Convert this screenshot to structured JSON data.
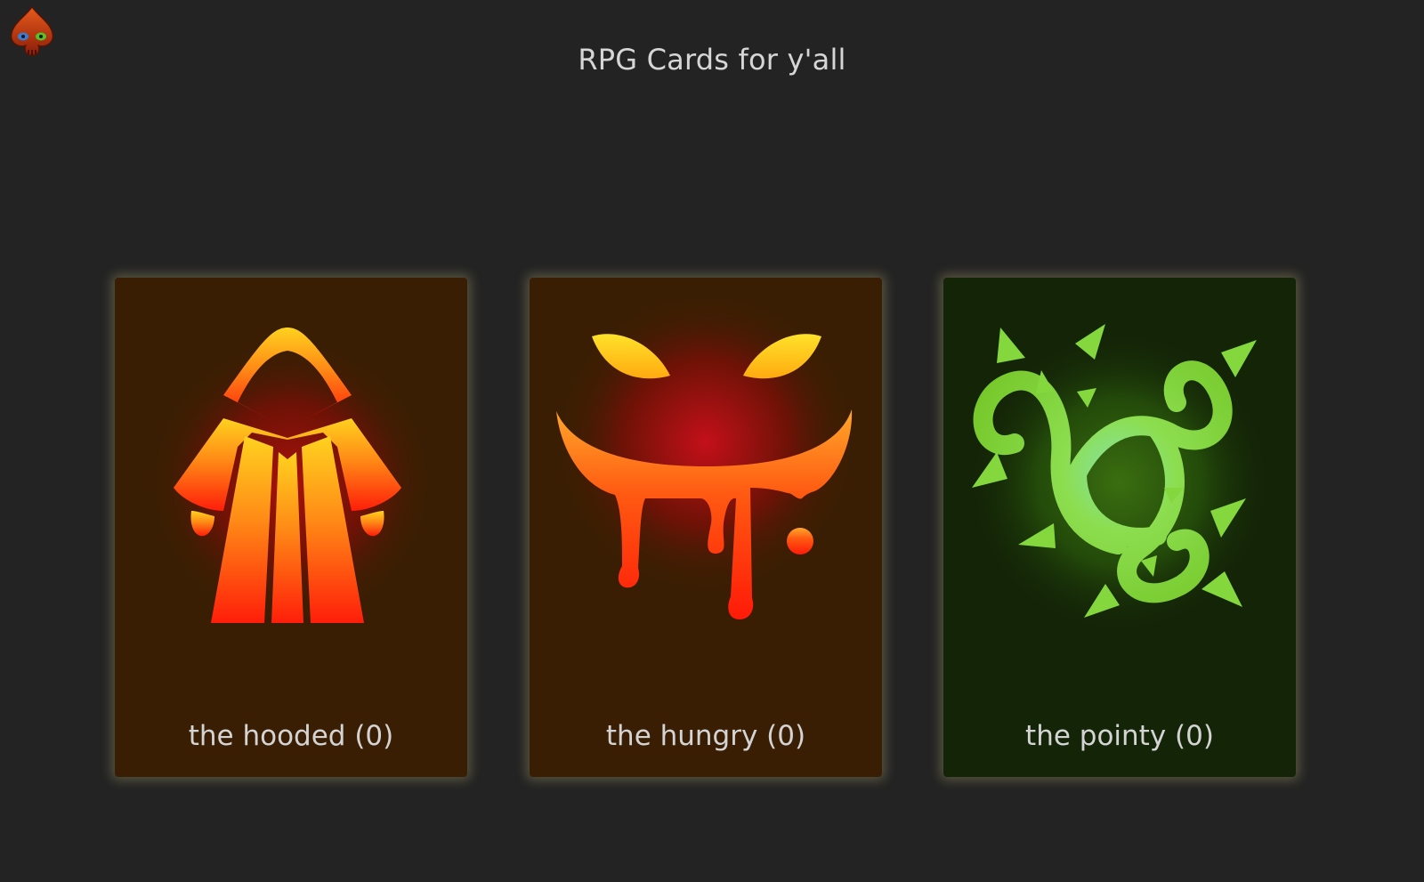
{
  "header": {
    "title": "RPG Cards for y'all",
    "logo_icon": "spade-skull-icon"
  },
  "cards": [
    {
      "label": "the hooded (0)",
      "icon": "hooded-robe-icon",
      "theme": "fire"
    },
    {
      "label": "the hungry (0)",
      "icon": "dripping-grin-icon",
      "theme": "fire"
    },
    {
      "label": "the pointy (0)",
      "icon": "thorny-triskelion-icon",
      "theme": "thorn"
    }
  ],
  "colors": {
    "page_background": "#232323",
    "fire_card_background": "#3a1e03",
    "thorn_card_background": "#142507",
    "card_glow": "#d0c882",
    "text": "#d6d6d6",
    "fire_yellow": "#ffd21f",
    "fire_orange": "#ff8a16",
    "fire_red": "#ff1e0a",
    "thorn_green": "#7fd838"
  }
}
